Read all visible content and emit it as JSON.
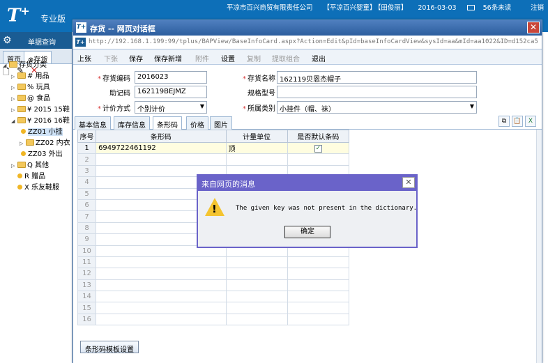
{
  "header": {
    "brand": "T",
    "brand_sup": "+",
    "edition": "专业版",
    "company": "平凉市百兴商贸有限责任公司",
    "account": "【平凉百兴婴童】",
    "user": "【田俊丽】",
    "date": "2016-03-03",
    "unread": "56条未读",
    "logout": "注销"
  },
  "left": {
    "menu_label": "单据查询",
    "tabs": [
      "首页",
      "存货"
    ],
    "tree": [
      {
        "label": "存货分类",
        "indent": 0
      },
      {
        "label": "# 用品",
        "indent": 1
      },
      {
        "label": "% 玩具",
        "indent": 1
      },
      {
        "label": "@ 食品",
        "indent": 1
      },
      {
        "label": "¥ 2015 15鞋",
        "indent": 1
      },
      {
        "label": "¥ 2016 16鞋",
        "indent": 1
      },
      {
        "label": "ZZ01 小挂",
        "indent": 2
      },
      {
        "label": "ZZ02 内衣",
        "indent": 2
      },
      {
        "label": "ZZ03 外出",
        "indent": 2
      },
      {
        "label": "Q 其他",
        "indent": 1
      },
      {
        "label": "R 赠品",
        "indent": 1
      },
      {
        "label": "X 乐友鞋服",
        "indent": 1
      }
    ]
  },
  "dialog": {
    "title": "存货 -- 网页对话框",
    "url": "http://192.168.1.199:99/tplus/BAPView/BaseInfoCard.aspx?Action=Edit&pId=baseInfoCardView&sysId=aa&mId=aa1022&ID=d152ca5b-f",
    "toolbar": [
      "上张",
      "下张",
      "保存",
      "保存新增",
      "附件",
      "设置",
      "复制",
      "提取组合",
      "退出"
    ],
    "form": {
      "code_label": "存货编码",
      "code_value": "2016023",
      "name_label": "存货名称",
      "name_value": "162119贝恩杰帽子",
      "mnemonic_label": "助记码",
      "mnemonic_value": "162119BEJMZ",
      "spec_label": "规格型号",
      "spec_value": "",
      "pricing_label": "计价方式",
      "pricing_value": "个别计价",
      "category_label": "所属类别",
      "category_value": "小挂件（帽、袜）"
    },
    "tabs": [
      "基本信息",
      "库存信息",
      "条形码",
      "价格",
      "图片"
    ],
    "grid": {
      "headers": [
        "序号",
        "条形码",
        "计量单位",
        "是否默认条码"
      ],
      "rows": [
        {
          "no": "1",
          "barcode": "6949722461192",
          "unit": "顶",
          "default": "✓"
        },
        {
          "no": "2"
        },
        {
          "no": "3"
        },
        {
          "no": "4"
        },
        {
          "no": "5"
        },
        {
          "no": "6"
        },
        {
          "no": "7"
        },
        {
          "no": "8"
        },
        {
          "no": "9"
        },
        {
          "no": "10"
        },
        {
          "no": "11"
        },
        {
          "no": "12"
        },
        {
          "no": "13"
        },
        {
          "no": "14"
        },
        {
          "no": "15"
        },
        {
          "no": "16"
        }
      ]
    },
    "template_button": "条形码模板设置"
  },
  "message": {
    "title": "来自网页的消息",
    "text": "The given key was not present in the dictionary.",
    "ok": "确定"
  }
}
